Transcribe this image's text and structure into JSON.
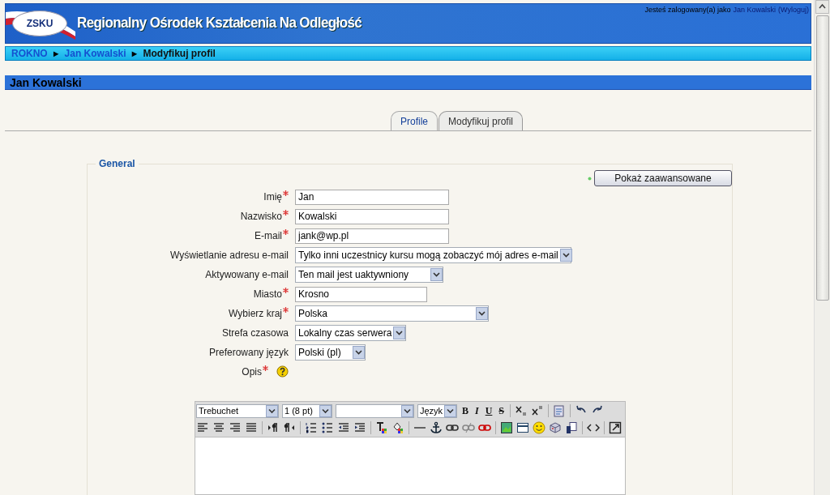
{
  "header": {
    "logo_text": "ZSKU",
    "title": "Regionalny Ośrodek Kształcenia Na Odległość",
    "login_text": "Jesteś zalogowany(a) jako",
    "login_user": "Jan Kowalski",
    "logout": "(Wyloguj)"
  },
  "breadcrumb": [
    {
      "label": "ROKNO",
      "link": true
    },
    {
      "label": "Jan Kowalski",
      "link": true
    },
    {
      "label": "Modyfikuj profil",
      "link": false
    }
  ],
  "breadcrumb_separator": "►",
  "page_heading": "Jan Kowalski",
  "tabs": [
    {
      "label": "Profile",
      "selected": false
    },
    {
      "label": "Modyfikuj profil",
      "selected": true
    }
  ],
  "form": {
    "legend": "General",
    "advanced_button": "Pokaż zaawansowane",
    "fields": [
      {
        "label": "Imię",
        "required": true,
        "kind": "text",
        "value": "Jan"
      },
      {
        "label": "Nazwisko",
        "required": true,
        "kind": "text",
        "value": "Kowalski"
      },
      {
        "label": "E-mail",
        "required": true,
        "kind": "text",
        "value": "jank@wp.pl"
      },
      {
        "label": "Wyświetlanie adresu e-mail",
        "required": false,
        "kind": "select",
        "value": "Tylko inni uczestnicy kursu mogą zobaczyć mój adres e-mail"
      },
      {
        "label": "Aktywowany e-mail",
        "required": false,
        "kind": "select",
        "value": "Ten mail jest uaktywniony"
      },
      {
        "label": "Miasto",
        "required": true,
        "kind": "text",
        "value": "Krosno"
      },
      {
        "label": "Wybierz kraj",
        "required": true,
        "kind": "select",
        "value": "Polska"
      },
      {
        "label": "Strefa czasowa",
        "required": false,
        "kind": "select",
        "value": "Lokalny czas serwera"
      },
      {
        "label": "Preferowany język",
        "required": false,
        "kind": "select",
        "value": "Polski (pl)"
      },
      {
        "label": "Opis",
        "required": true,
        "kind": "help"
      }
    ]
  },
  "editor": {
    "selects": [
      {
        "kind": "dropdown",
        "value": "Trebuchet"
      },
      {
        "kind": "dropdown",
        "value": "1 (8 pt)"
      },
      {
        "kind": "dropdown"
      },
      {
        "kind": "dropdown",
        "value": "Język"
      }
    ],
    "format_buttons": [
      "B",
      "I",
      "U",
      "S"
    ]
  }
}
